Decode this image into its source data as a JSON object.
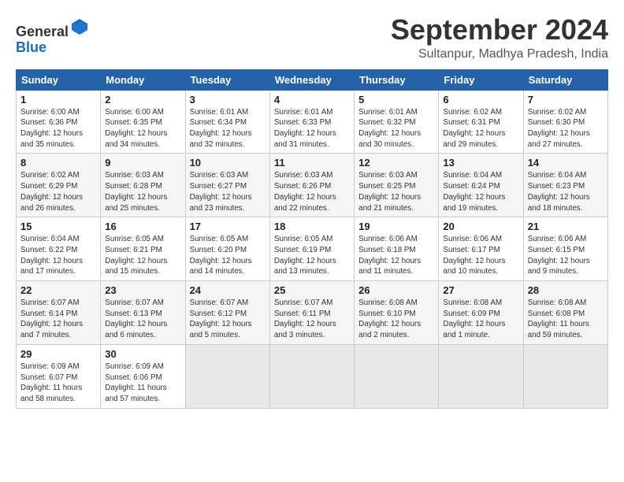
{
  "header": {
    "logo_general": "General",
    "logo_blue": "Blue",
    "month_title": "September 2024",
    "subtitle": "Sultanpur, Madhya Pradesh, India"
  },
  "weekdays": [
    "Sunday",
    "Monday",
    "Tuesday",
    "Wednesday",
    "Thursday",
    "Friday",
    "Saturday"
  ],
  "rows": [
    [
      {
        "day": "1",
        "sunrise": "6:00 AM",
        "sunset": "6:36 PM",
        "daylight": "12 hours and 35 minutes."
      },
      {
        "day": "2",
        "sunrise": "6:00 AM",
        "sunset": "6:35 PM",
        "daylight": "12 hours and 34 minutes."
      },
      {
        "day": "3",
        "sunrise": "6:01 AM",
        "sunset": "6:34 PM",
        "daylight": "12 hours and 32 minutes."
      },
      {
        "day": "4",
        "sunrise": "6:01 AM",
        "sunset": "6:33 PM",
        "daylight": "12 hours and 31 minutes."
      },
      {
        "day": "5",
        "sunrise": "6:01 AM",
        "sunset": "6:32 PM",
        "daylight": "12 hours and 30 minutes."
      },
      {
        "day": "6",
        "sunrise": "6:02 AM",
        "sunset": "6:31 PM",
        "daylight": "12 hours and 29 minutes."
      },
      {
        "day": "7",
        "sunrise": "6:02 AM",
        "sunset": "6:30 PM",
        "daylight": "12 hours and 27 minutes."
      }
    ],
    [
      {
        "day": "8",
        "sunrise": "6:02 AM",
        "sunset": "6:29 PM",
        "daylight": "12 hours and 26 minutes."
      },
      {
        "day": "9",
        "sunrise": "6:03 AM",
        "sunset": "6:28 PM",
        "daylight": "12 hours and 25 minutes."
      },
      {
        "day": "10",
        "sunrise": "6:03 AM",
        "sunset": "6:27 PM",
        "daylight": "12 hours and 23 minutes."
      },
      {
        "day": "11",
        "sunrise": "6:03 AM",
        "sunset": "6:26 PM",
        "daylight": "12 hours and 22 minutes."
      },
      {
        "day": "12",
        "sunrise": "6:03 AM",
        "sunset": "6:25 PM",
        "daylight": "12 hours and 21 minutes."
      },
      {
        "day": "13",
        "sunrise": "6:04 AM",
        "sunset": "6:24 PM",
        "daylight": "12 hours and 19 minutes."
      },
      {
        "day": "14",
        "sunrise": "6:04 AM",
        "sunset": "6:23 PM",
        "daylight": "12 hours and 18 minutes."
      }
    ],
    [
      {
        "day": "15",
        "sunrise": "6:04 AM",
        "sunset": "6:22 PM",
        "daylight": "12 hours and 17 minutes."
      },
      {
        "day": "16",
        "sunrise": "6:05 AM",
        "sunset": "6:21 PM",
        "daylight": "12 hours and 15 minutes."
      },
      {
        "day": "17",
        "sunrise": "6:05 AM",
        "sunset": "6:20 PM",
        "daylight": "12 hours and 14 minutes."
      },
      {
        "day": "18",
        "sunrise": "6:05 AM",
        "sunset": "6:19 PM",
        "daylight": "12 hours and 13 minutes."
      },
      {
        "day": "19",
        "sunrise": "6:06 AM",
        "sunset": "6:18 PM",
        "daylight": "12 hours and 11 minutes."
      },
      {
        "day": "20",
        "sunrise": "6:06 AM",
        "sunset": "6:17 PM",
        "daylight": "12 hours and 10 minutes."
      },
      {
        "day": "21",
        "sunrise": "6:06 AM",
        "sunset": "6:15 PM",
        "daylight": "12 hours and 9 minutes."
      }
    ],
    [
      {
        "day": "22",
        "sunrise": "6:07 AM",
        "sunset": "6:14 PM",
        "daylight": "12 hours and 7 minutes."
      },
      {
        "day": "23",
        "sunrise": "6:07 AM",
        "sunset": "6:13 PM",
        "daylight": "12 hours and 6 minutes."
      },
      {
        "day": "24",
        "sunrise": "6:07 AM",
        "sunset": "6:12 PM",
        "daylight": "12 hours and 5 minutes."
      },
      {
        "day": "25",
        "sunrise": "6:07 AM",
        "sunset": "6:11 PM",
        "daylight": "12 hours and 3 minutes."
      },
      {
        "day": "26",
        "sunrise": "6:08 AM",
        "sunset": "6:10 PM",
        "daylight": "12 hours and 2 minutes."
      },
      {
        "day": "27",
        "sunrise": "6:08 AM",
        "sunset": "6:09 PM",
        "daylight": "12 hours and 1 minute."
      },
      {
        "day": "28",
        "sunrise": "6:08 AM",
        "sunset": "6:08 PM",
        "daylight": "11 hours and 59 minutes."
      }
    ],
    [
      {
        "day": "29",
        "sunrise": "6:09 AM",
        "sunset": "6:07 PM",
        "daylight": "11 hours and 58 minutes."
      },
      {
        "day": "30",
        "sunrise": "6:09 AM",
        "sunset": "6:06 PM",
        "daylight": "11 hours and 57 minutes."
      },
      null,
      null,
      null,
      null,
      null
    ]
  ],
  "labels": {
    "sunrise": "Sunrise:",
    "sunset": "Sunset:",
    "daylight": "Daylight:"
  }
}
